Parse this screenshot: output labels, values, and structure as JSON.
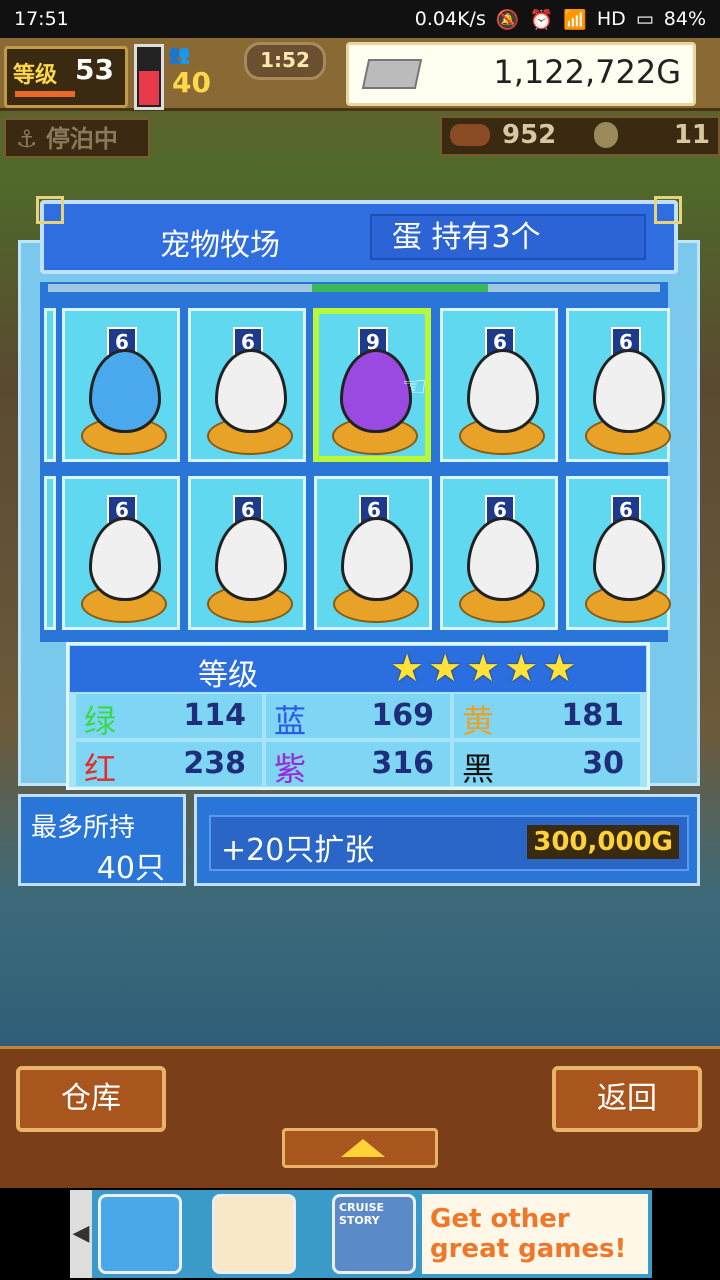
{
  "status_bar": {
    "time": "17:51",
    "network": "0.04K/s",
    "hd": "HD",
    "battery": "84%"
  },
  "hud": {
    "level_label": "等级",
    "level_value": "53",
    "people_value": "40",
    "clock": "1:52",
    "money": "1,122,722G",
    "docked_label": "停泊中",
    "food_value": "952",
    "coin_value": "11"
  },
  "panel": {
    "title": "宠物牧场",
    "egg_count": "蛋 持有3个",
    "eggs_row1": [
      {
        "level": "6",
        "color": "blue"
      },
      {
        "level": "6",
        "color": "white"
      },
      {
        "level": "9",
        "color": "purple",
        "selected": true
      },
      {
        "level": "6",
        "color": "white"
      },
      {
        "level": "6",
        "color": "white"
      }
    ],
    "eggs_row2": [
      {
        "level": "6",
        "color": "white"
      },
      {
        "level": "6",
        "color": "white"
      },
      {
        "level": "6",
        "color": "white"
      },
      {
        "level": "6",
        "color": "white"
      },
      {
        "level": "6",
        "color": "white"
      }
    ]
  },
  "grade": {
    "label": "等级",
    "stars": 5,
    "stats": [
      {
        "key": "绿",
        "value": "114",
        "color": "#3ad84a"
      },
      {
        "key": "蓝",
        "value": "169",
        "color": "#2a5ae8"
      },
      {
        "key": "黄",
        "value": "181",
        "color": "#e8a22a"
      },
      {
        "key": "红",
        "value": "238",
        "color": "#e82a2a"
      },
      {
        "key": "紫",
        "value": "316",
        "color": "#9a2ad8"
      },
      {
        "key": "黑",
        "value": "30",
        "color": "#111111"
      }
    ]
  },
  "max_holding": {
    "label": "最多所持",
    "value": "40只"
  },
  "expand": {
    "label": "+20只扩张",
    "price": "300,000G"
  },
  "buttons": {
    "warehouse": "仓库",
    "back": "返回"
  },
  "ad": {
    "cruise_label": "CRUISE STORY",
    "promo": "Get other great games!"
  }
}
